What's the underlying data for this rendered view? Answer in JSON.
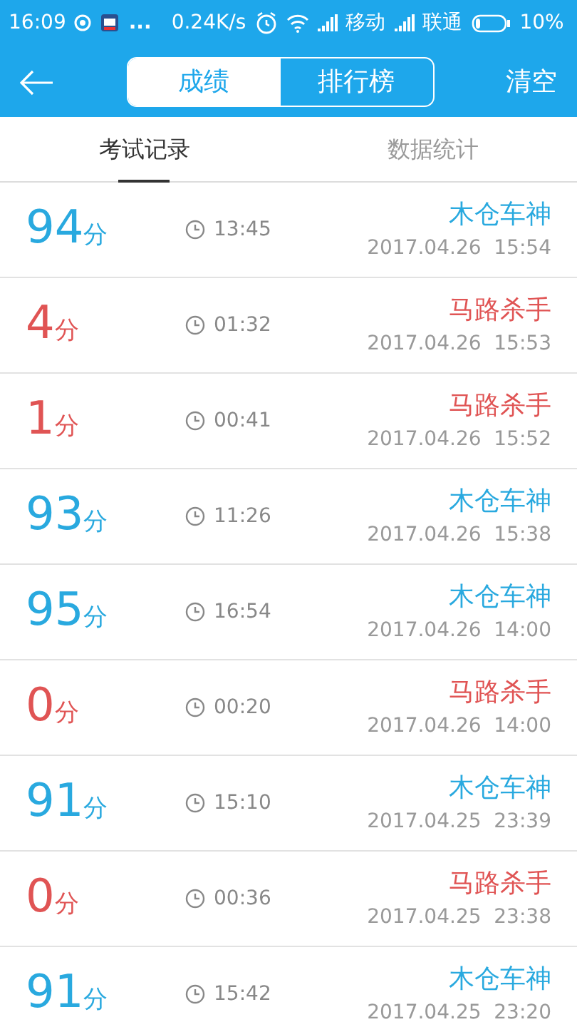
{
  "status_bar": {
    "time": "16:09",
    "more": "...",
    "speed": "0.24K/s",
    "carrier_1": "移动",
    "carrier_2": "联通",
    "battery": "10%"
  },
  "header": {
    "segments": [
      {
        "label": "成绩",
        "selected": true
      },
      {
        "label": "排行榜",
        "selected": false
      }
    ],
    "action": "清空"
  },
  "tabs": [
    {
      "label": "考试记录",
      "selected": true
    },
    {
      "label": "数据统计",
      "selected": false
    }
  ],
  "records": [
    {
      "kind": "pass",
      "score": "94",
      "unit": "分",
      "duration": "13:45",
      "title": "木仓车神",
      "date": "2017.04.26  15:54"
    },
    {
      "kind": "fail",
      "score": "4",
      "unit": "分",
      "duration": "01:32",
      "title": "马路杀手",
      "date": "2017.04.26  15:53"
    },
    {
      "kind": "fail",
      "score": "1",
      "unit": "分",
      "duration": "00:41",
      "title": "马路杀手",
      "date": "2017.04.26  15:52"
    },
    {
      "kind": "pass",
      "score": "93",
      "unit": "分",
      "duration": "11:26",
      "title": "木仓车神",
      "date": "2017.04.26  15:38"
    },
    {
      "kind": "pass",
      "score": "95",
      "unit": "分",
      "duration": "16:54",
      "title": "木仓车神",
      "date": "2017.04.26  14:00"
    },
    {
      "kind": "fail",
      "score": "0",
      "unit": "分",
      "duration": "00:20",
      "title": "马路杀手",
      "date": "2017.04.26  14:00"
    },
    {
      "kind": "pass",
      "score": "91",
      "unit": "分",
      "duration": "15:10",
      "title": "木仓车神",
      "date": "2017.04.25  23:39"
    },
    {
      "kind": "fail",
      "score": "0",
      "unit": "分",
      "duration": "00:36",
      "title": "马路杀手",
      "date": "2017.04.25  23:38"
    },
    {
      "kind": "pass",
      "score": "91",
      "unit": "分",
      "duration": "15:42",
      "title": "木仓车神",
      "date": "2017.04.25  23:20"
    }
  ]
}
